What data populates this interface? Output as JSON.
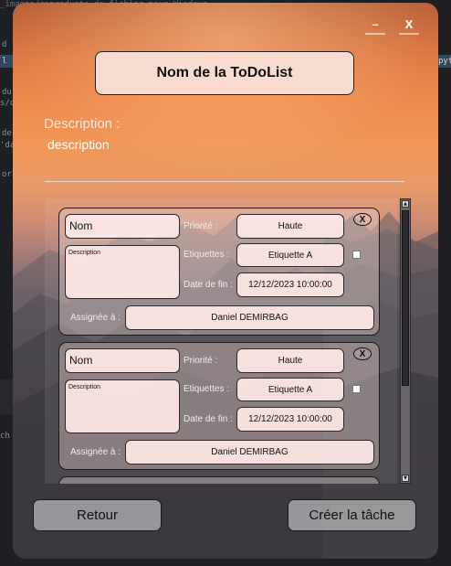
{
  "window": {
    "minimize_label": "–",
    "close_label": "X"
  },
  "todolist": {
    "title": "Nom de la ToDoList",
    "description_label": "Description :",
    "description_value": "description"
  },
  "tasks": [
    {
      "name_value": "Nom",
      "description_placeholder": "Description",
      "priority_label": "Priorité :",
      "priority_value": "Haute",
      "tags_label": "Etiquettes :",
      "tags_value": "Etiquette A",
      "end_date_label": "Date de fin :",
      "end_date_value": "12/12/2023 10:00:00",
      "assigned_label": "Assignée à :",
      "assigned_value": "Daniel DEMIRBAG",
      "remove_label": "X",
      "checked": false
    },
    {
      "name_value": "Nom",
      "description_placeholder": "Description",
      "priority_label": "Priorité :",
      "priority_value": "Haute",
      "tags_label": "Etiquettes :",
      "tags_value": "Etiquette A",
      "end_date_label": "Date de fin :",
      "end_date_value": "12/12/2023 10:00:00",
      "assigned_label": "Assignée à :",
      "assigned_value": "Daniel DEMIRBAG",
      "remove_label": "X",
      "checked": false
    }
  ],
  "footer": {
    "back_label": "Retour",
    "create_label": "Créer la tâche"
  },
  "background_ide": {
    "line1": "_images/reproducts.de.fichier.pour.Windows",
    "line2": "d",
    "line3": "l",
    "line4": "du",
    "line5": "s/d",
    "line6": "de",
    "line7": "'da",
    "line8": "or",
    "line9": "ch",
    "right1": "pyt"
  },
  "colors": {
    "title_box_bg": "#f8e1d7",
    "field_bg": "#fce6e4",
    "button_bg": "#a09ea2",
    "sky_orange": "#ef8a4e"
  }
}
